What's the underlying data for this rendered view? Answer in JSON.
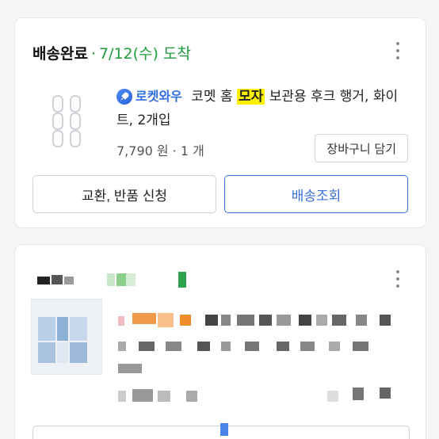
{
  "order": {
    "status_label": "배송완료",
    "status_separator": "·",
    "status_date": "7/12(수) 도착",
    "badge_text": "로켓와우",
    "product_prefix": "코멧 홈",
    "product_highlight": "모자",
    "product_suffix": "보관용 후크 행거, 화이트, 2개입",
    "price": "7,790 원",
    "quantity": "1 개",
    "price_separator": "·",
    "cart_button": "장바구니 담기",
    "exchange_button": "교환, 반품 신청",
    "tracking_button": "배송조회"
  },
  "colors": {
    "status_green": "#1f9c3f",
    "accent_blue": "#3a6fd8",
    "highlight": "#fff200"
  },
  "icons": {
    "more": "kebab-menu-icon",
    "rocket": "rocket-icon"
  }
}
